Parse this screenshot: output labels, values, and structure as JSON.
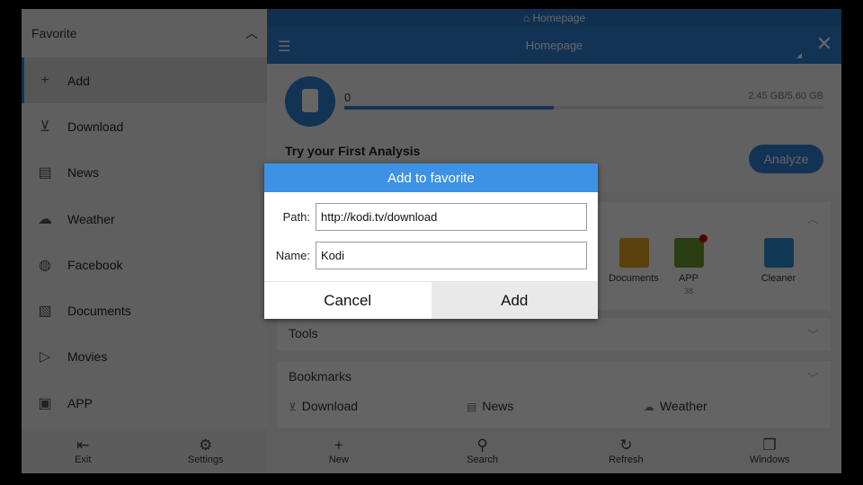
{
  "sidebar": {
    "title": "Favorite",
    "items": [
      {
        "label": "Add",
        "icon": "plus-icon",
        "glyph": "+"
      },
      {
        "label": "Download",
        "icon": "download-folder-icon",
        "glyph": "⊻"
      },
      {
        "label": "News",
        "icon": "news-icon",
        "glyph": "▤"
      },
      {
        "label": "Weather",
        "icon": "cloud-rain-icon",
        "glyph": "☁"
      },
      {
        "label": "Facebook",
        "icon": "globe-icon",
        "glyph": "◍"
      },
      {
        "label": "Documents",
        "icon": "document-wifi-icon",
        "glyph": "▧"
      },
      {
        "label": "Movies",
        "icon": "movie-wifi-icon",
        "glyph": "▷"
      },
      {
        "label": "APP",
        "icon": "app-wifi-icon",
        "glyph": "▣"
      }
    ],
    "footer": {
      "exit": "Exit",
      "settings": "Settings"
    }
  },
  "main": {
    "top_tab": "Homepage",
    "header_title": "Homepage",
    "storage": {
      "count": "0",
      "used": "2.45 GB",
      "total": "5.60 GB",
      "used_fraction": 0.4375
    },
    "analysis_title": "Try your First Analysis",
    "analyze_label": "Analyze",
    "categories": [
      {
        "label": "Documents",
        "color": "#e0a020"
      },
      {
        "label": "APP",
        "count": "38",
        "color": "#6a9c2a",
        "badge": true
      },
      {
        "label": "Cleaner",
        "color": "#2e8fd0"
      }
    ],
    "tools_title": "Tools",
    "bookmarks": {
      "title": "Bookmarks",
      "items": [
        "Download",
        "News",
        "Weather"
      ]
    },
    "footer": {
      "new": "New",
      "search": "Search",
      "refresh": "Refresh",
      "windows": "Windows"
    }
  },
  "dialog": {
    "title": "Add to favorite",
    "path_label": "Path:",
    "path_value": "http://kodi.tv/download",
    "name_label": "Name:",
    "name_value": "Kodi",
    "cancel": "Cancel",
    "add": "Add"
  },
  "colors": {
    "accent": "#2f80d5",
    "dialog_header": "#3d92e6",
    "badge": "#cc0000"
  }
}
